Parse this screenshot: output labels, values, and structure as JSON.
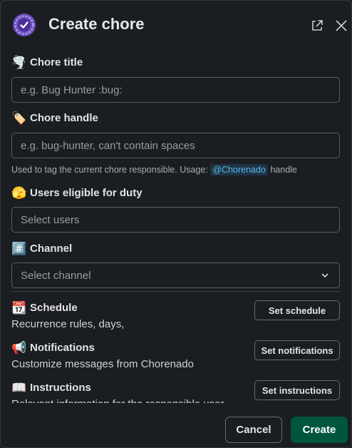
{
  "modal": {
    "title": "Create chore"
  },
  "fields": {
    "chore_title": {
      "emoji": "🌪️",
      "label": "Chore title",
      "placeholder": "e.g. Bug Hunter :bug:"
    },
    "chore_handle": {
      "emoji": "🏷️",
      "label": "Chore handle",
      "placeholder": "e.g. bug-hunter, can't contain spaces",
      "hint_before": "Used to tag the current chore responsible. Usage: ",
      "hint_mention": "@Chorenado",
      "hint_after": " handle"
    },
    "users": {
      "emoji": "🫣",
      "label": "Users eligible for duty",
      "placeholder": "Select users"
    },
    "channel": {
      "emoji": "#️⃣",
      "label": "Channel",
      "placeholder": "Select channel"
    }
  },
  "sections": {
    "schedule": {
      "emoji": "📆",
      "label": "Schedule",
      "description": "Recurrence rules, days,",
      "button": "Set schedule"
    },
    "notifications": {
      "emoji": "📢",
      "label": "Notifications",
      "description": "Customize messages from Chorenado",
      "button": "Set notifications"
    },
    "instructions": {
      "emoji": "📖",
      "label": "Instructions",
      "description": "Relevant information for the responsible user",
      "button": "Set instructions"
    }
  },
  "footer": {
    "cancel_label": "Cancel",
    "create_label": "Create"
  },
  "colors": {
    "background": "#1a1d21",
    "primary_button": "#00553d",
    "mention_bg": "#1d3445",
    "mention_text": "#5eb5e8",
    "app_icon": "#6b4fbb"
  }
}
